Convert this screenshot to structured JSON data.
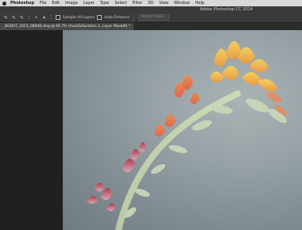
{
  "menubar": {
    "app": "Photoshop",
    "items": [
      "File",
      "Edit",
      "Image",
      "Layer",
      "Type",
      "Select",
      "Filter",
      "3D",
      "View",
      "Window",
      "Help"
    ]
  },
  "optionsbar": {
    "window_title": "Adobe Photoshop CC 2014",
    "sample_all_layers": "Sample All Layers",
    "auto_enhance": "Auto-Enhance",
    "refine_edge": "Refine Edge..."
  },
  "document": {
    "tab_label": "_BGD07_2013_0894D.dng @ 66.7% (Hue/Saturation 1, Layer Mask/8) *"
  },
  "colors": {
    "canvas_bg": "#97a2a6",
    "workspace": "#202020",
    "menubar": "#d8d8d8"
  }
}
